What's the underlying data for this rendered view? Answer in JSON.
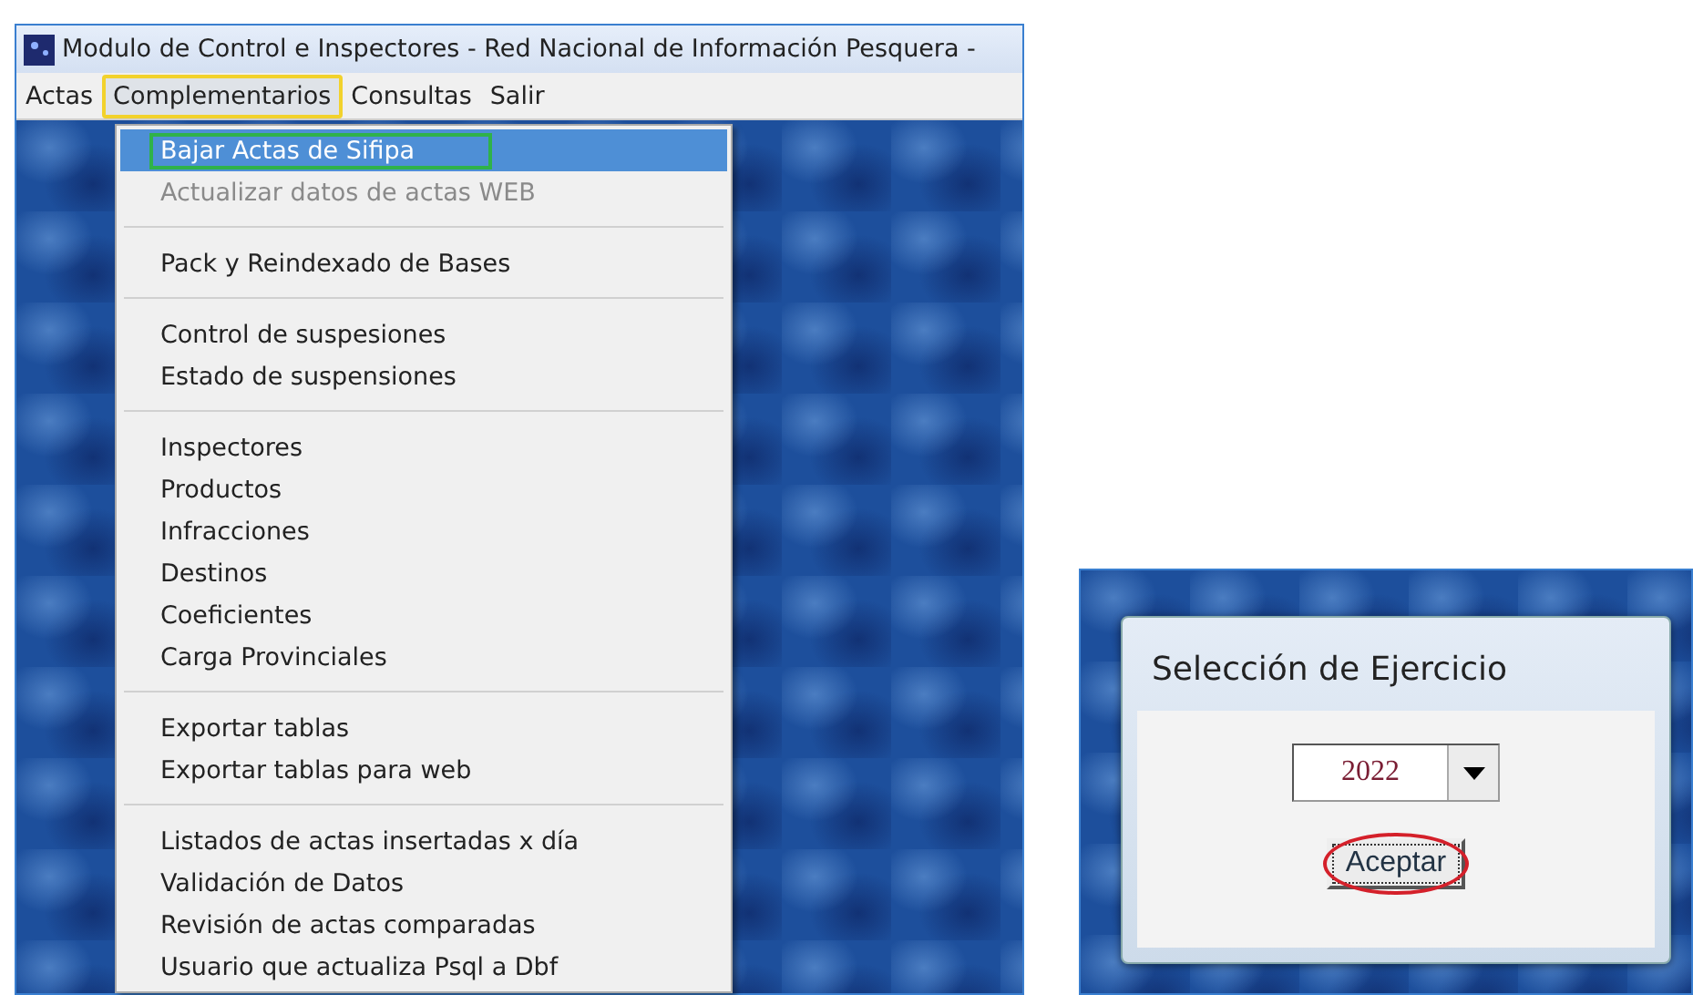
{
  "main_window": {
    "title": "Modulo de Control e Inspectores - Red Nacional de Información Pesquera -",
    "menu_bar": [
      {
        "label": "Actas",
        "selected": false
      },
      {
        "label": "Complementarios",
        "selected": true
      },
      {
        "label": "Consultas",
        "selected": false
      },
      {
        "label": "Salir",
        "selected": false
      }
    ],
    "dropdown_groups": [
      [
        {
          "label": "Bajar Actas de Sifipa",
          "selected": true,
          "disabled": false
        },
        {
          "label": "Actualizar datos de actas WEB",
          "selected": false,
          "disabled": true
        }
      ],
      [
        {
          "label": "Pack y Reindexado de Bases",
          "selected": false,
          "disabled": false
        }
      ],
      [
        {
          "label": "Control de suspesiones",
          "selected": false,
          "disabled": false
        },
        {
          "label": "Estado de suspensiones",
          "selected": false,
          "disabled": false
        }
      ],
      [
        {
          "label": "Inspectores",
          "selected": false,
          "disabled": false
        },
        {
          "label": "Productos",
          "selected": false,
          "disabled": false
        },
        {
          "label": "Infracciones",
          "selected": false,
          "disabled": false
        },
        {
          "label": "Destinos",
          "selected": false,
          "disabled": false
        },
        {
          "label": "Coeficientes",
          "selected": false,
          "disabled": false
        },
        {
          "label": "Carga Provinciales",
          "selected": false,
          "disabled": false
        }
      ],
      [
        {
          "label": "Exportar tablas",
          "selected": false,
          "disabled": false
        },
        {
          "label": "Exportar tablas para web",
          "selected": false,
          "disabled": false
        }
      ],
      [
        {
          "label": "Listados de actas insertadas x día",
          "selected": false,
          "disabled": false
        },
        {
          "label": "Validación de Datos",
          "selected": false,
          "disabled": false
        },
        {
          "label": "Revisión de actas comparadas",
          "selected": false,
          "disabled": false
        },
        {
          "label": "Usuario que actualiza Psql a Dbf",
          "selected": false,
          "disabled": false
        }
      ]
    ]
  },
  "year_dialog": {
    "title": "Selección de Ejercicio",
    "year": "2022",
    "button": "Aceptar"
  }
}
